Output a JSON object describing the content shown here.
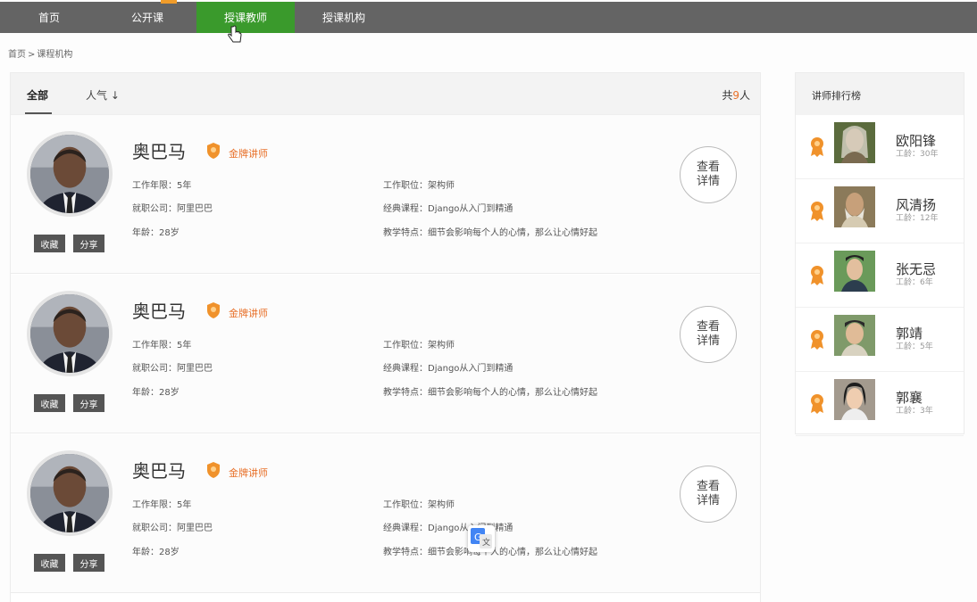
{
  "nav": {
    "items": [
      {
        "label": "首页"
      },
      {
        "label": "公开课"
      },
      {
        "label": "授课教师"
      },
      {
        "label": "授课机构"
      }
    ],
    "active_index": 2
  },
  "breadcrumb": {
    "home": "首页",
    "sep": ">",
    "current": "课程机构"
  },
  "list": {
    "tab_all": "全部",
    "tab_popular": "人气 ↓",
    "total_prefix": "共",
    "total_count": "9",
    "total_suffix": "人"
  },
  "teachers": [
    {
      "name": "奥巴马",
      "badge": "金牌讲师",
      "work_years": "工作年限：5年",
      "position": "工作职位：架构师",
      "company": "就职公司：阿里巴巴",
      "course": "经典课程：Django从入门到精通",
      "age": "年龄：28岁",
      "feature": "教学特点：细节会影响每个人的心情，那么让心情好起",
      "fav": "收藏",
      "share": "分享",
      "detail": "查看详情"
    },
    {
      "name": "奥巴马",
      "badge": "金牌讲师",
      "work_years": "工作年限：5年",
      "position": "工作职位：架构师",
      "company": "就职公司：阿里巴巴",
      "course": "经典课程：Django从入门到精通",
      "age": "年龄：28岁",
      "feature": "教学特点：细节会影响每个人的心情，那么让心情好起",
      "fav": "收藏",
      "share": "分享",
      "detail": "查看详情"
    },
    {
      "name": "奥巴马",
      "badge": "金牌讲师",
      "work_years": "工作年限：5年",
      "position": "工作职位：架构师",
      "company": "就职公司：阿里巴巴",
      "course": "经典课程：Django从入门到精通",
      "age": "年龄：28岁",
      "feature": "教学特点：细节会影响每个人的心情，那么让心情好起",
      "fav": "收藏",
      "share": "分享",
      "detail": "查看详情"
    }
  ],
  "ranking": {
    "title": "讲师排行榜",
    "items": [
      {
        "name": "欧阳锋",
        "age": "工龄：30年"
      },
      {
        "name": "风清扬",
        "age": "工龄：12年"
      },
      {
        "name": "张无忌",
        "age": "工龄：6年"
      },
      {
        "name": "郭靖",
        "age": "工龄：5年"
      },
      {
        "name": "郭襄",
        "age": "工龄：3年"
      }
    ]
  },
  "colors": {
    "nav_bg": "#646464",
    "nav_active": "#3a9a2c",
    "accent": "#e8712a"
  }
}
